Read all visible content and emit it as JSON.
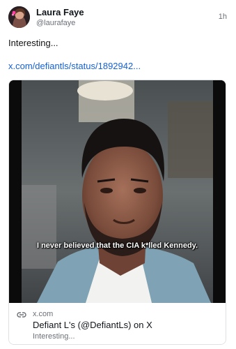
{
  "author": {
    "name": "Laura Faye",
    "handle": "@laurafaye"
  },
  "timestamp": "1h",
  "post": {
    "text": "Interesting...",
    "link": "x.com/defiantls/status/1892942..."
  },
  "embed": {
    "caption": "I never believed that the CIA k*lled Kennedy.",
    "domain": "x.com",
    "title": "Defiant L's (@DefiantLs) on X",
    "description": "Interesting..."
  },
  "icons": {
    "link": "link-icon"
  },
  "colors": {
    "link": "#1460d6",
    "muted": "#6b6f76",
    "text": "#0f1419"
  }
}
